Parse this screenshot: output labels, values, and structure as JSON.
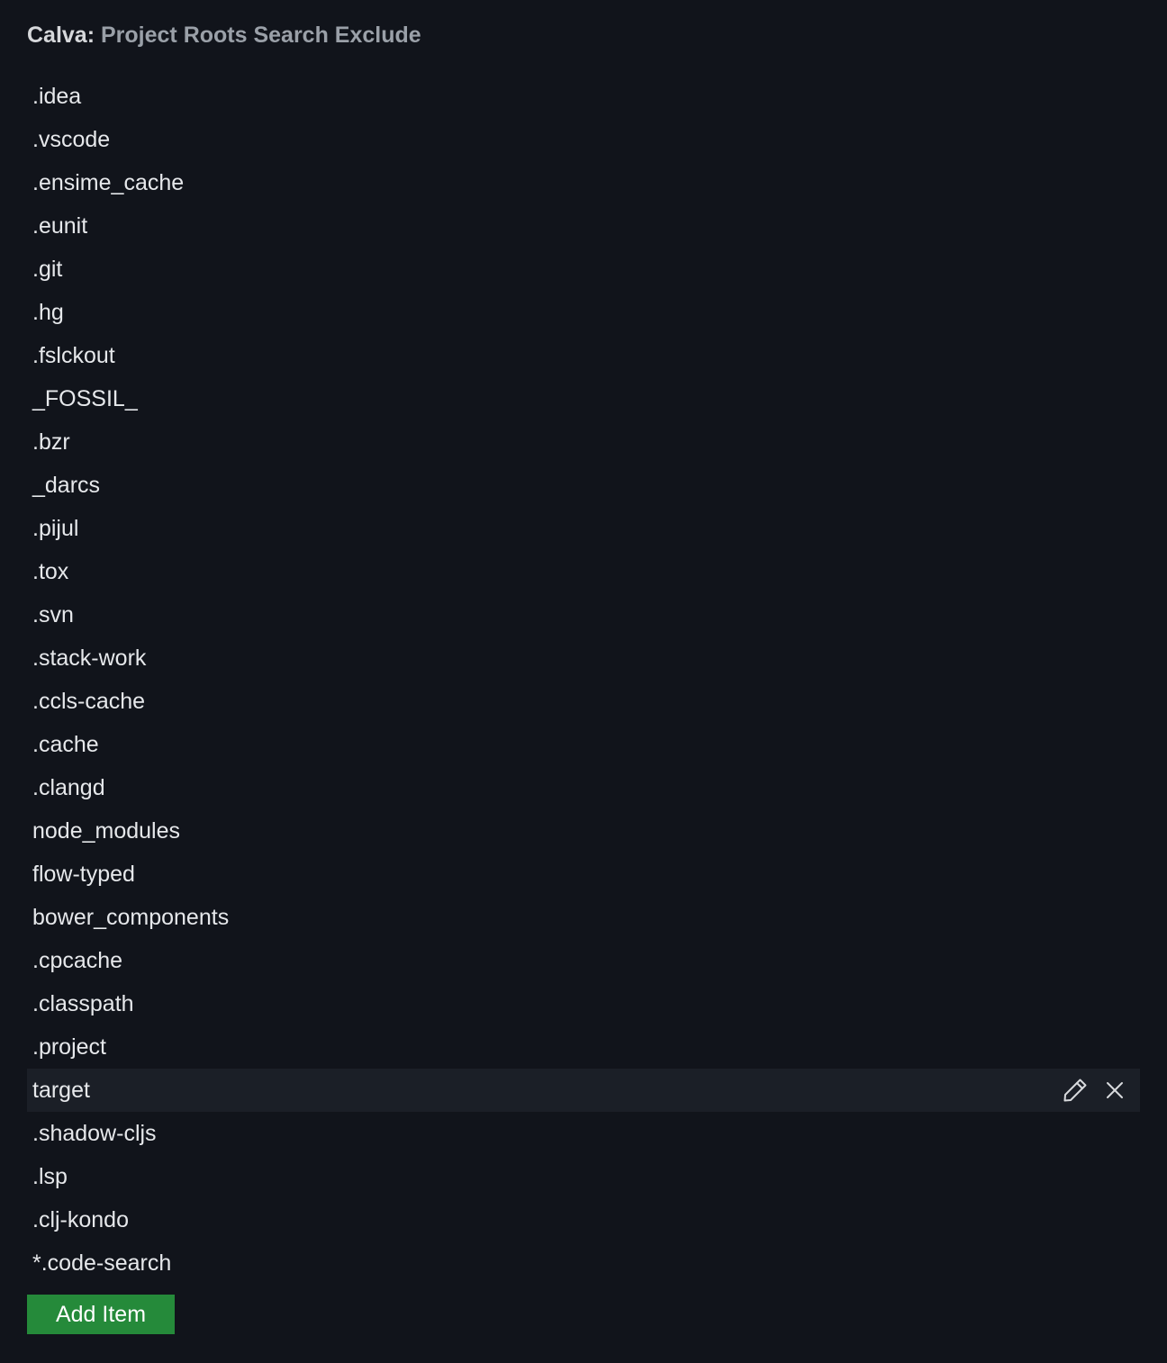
{
  "setting": {
    "category": "Calva:",
    "name": "Project Roots Search Exclude"
  },
  "items": [
    {
      "label": ".idea"
    },
    {
      "label": ".vscode"
    },
    {
      "label": ".ensime_cache"
    },
    {
      "label": ".eunit"
    },
    {
      "label": ".git"
    },
    {
      "label": ".hg"
    },
    {
      "label": ".fslckout"
    },
    {
      "label": "_FOSSIL_"
    },
    {
      "label": ".bzr"
    },
    {
      "label": "_darcs"
    },
    {
      "label": ".pijul"
    },
    {
      "label": ".tox"
    },
    {
      "label": ".svn"
    },
    {
      "label": ".stack-work"
    },
    {
      "label": ".ccls-cache"
    },
    {
      "label": ".cache"
    },
    {
      "label": ".clangd"
    },
    {
      "label": "node_modules"
    },
    {
      "label": "flow-typed"
    },
    {
      "label": "bower_components"
    },
    {
      "label": ".cpcache"
    },
    {
      "label": ".classpath"
    },
    {
      "label": ".project"
    },
    {
      "label": "target",
      "hovered": true
    },
    {
      "label": ".shadow-cljs"
    },
    {
      "label": ".lsp"
    },
    {
      "label": ".clj-kondo"
    },
    {
      "label": "*.code-search"
    }
  ],
  "row_actions": {
    "edit_icon": "pencil-icon",
    "remove_icon": "close-icon"
  },
  "add_button": {
    "label": "Add Item",
    "color": "#258a3a"
  }
}
